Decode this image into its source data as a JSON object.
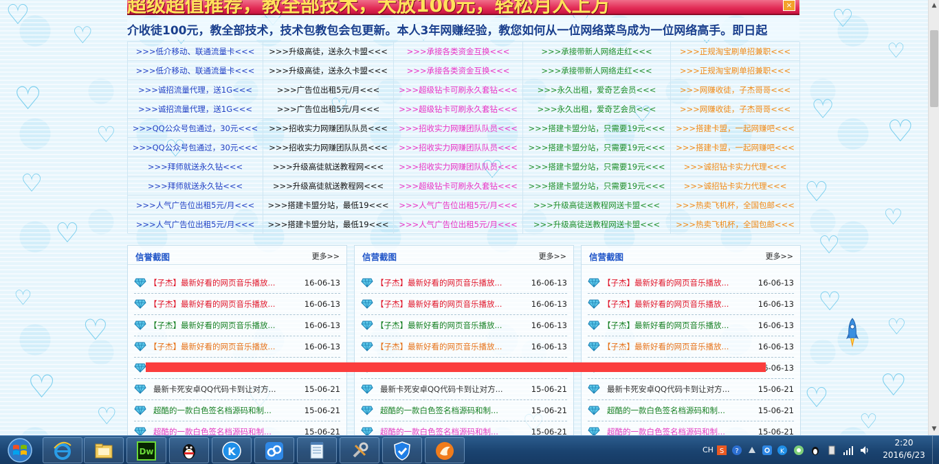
{
  "banner": {
    "text": "超级超值推荐，教全部技术，大放100元，轻松月入上万",
    "close_label": "×"
  },
  "marquee": {
    "text": "介收徒100元，教全部技术，技术包教包会包更新。本人3年网赚经验，教您如何从一位网络菜鸟成为一位网络高手。即日起"
  },
  "ad_grid": {
    "rows": [
      [
        ">>>低介移动、联通流量卡<<<",
        ">>>升级高徒，送永久卡盟<<<",
        ">>>承接各类资金互换<<<",
        ">>>承接带新人网络走红<<<",
        ">>>正规淘宝刷单招兼职<<<"
      ],
      [
        ">>>低介移动、联通流量卡<<<",
        ">>>升级高徒，送永久卡盟<<<",
        ">>>承接各类资金互换<<<",
        ">>>承接带新人网络走红<<<",
        ">>>正规淘宝刷单招兼职<<<"
      ],
      [
        ">>>诚招流量代理，送1G<<<",
        ">>>广告位出租5元/月<<<",
        ">>>超级钻卡可刷永久套钻<<<",
        ">>>永久出租，爱奇艺会员<<<",
        ">>>网赚收徒，子杰哥哥<<<"
      ],
      [
        ">>>诚招流量代理，送1G<<<",
        ">>>广告位出租5元/月<<<",
        ">>>超级钻卡可刷永久套钻<<<",
        ">>>永久出租，爱奇艺会员<<<",
        ">>>网赚收徒，子杰哥哥<<<"
      ],
      [
        ">>>QQ公众号包通过，30元<<<",
        ">>>招收实力网赚团队队员<<<",
        ">>>招收实力网赚团队队员<<<",
        ">>>搭建卡盟分站，只需要19元<<<",
        ">>>搭建卡盟，一起网赚吧<<<"
      ],
      [
        ">>>QQ公众号包通过，30元<<<",
        ">>>招收实力网赚团队队员<<<",
        ">>>招收实力网赚团队队员<<<",
        ">>>搭建卡盟分站，只需要19元<<<",
        ">>>搭建卡盟，一起网赚吧<<<"
      ],
      [
        ">>>拜师就送永久钻<<<",
        ">>>升级高徒就送教程网<<<",
        ">>>招收实力网赚团队队员<<<",
        ">>>搭建卡盟分站，只需要19元<<<",
        ">>>诚招钻卡实力代理<<<"
      ],
      [
        ">>>拜师就送永久钻<<<",
        ">>>升级高徒就送教程网<<<",
        ">>>超级钻卡可刷永久套钻<<<",
        ">>>搭建卡盟分站，只需要19元<<<",
        ">>>诚招钻卡实力代理<<<"
      ],
      [
        ">>>人气广告位出租5元/月<<<",
        ">>>搭建卡盟分站，最低19<<<",
        ">>>人气广告位出租5元/月<<<",
        ">>>升级高徒送教程网送卡盟<<<",
        ">>>热卖飞机杯，全国包邮<<<"
      ],
      [
        ">>>人气广告位出租5元/月<<<",
        ">>>搭建卡盟分站，最低19<<<",
        ">>>人气广告位出租5元/月<<<",
        ">>>升级高徒送教程网送卡盟<<<",
        ">>>热卖飞机杯，全国包邮<<<"
      ]
    ]
  },
  "panels": [
    {
      "title": "信誉截图",
      "more": "更多>>",
      "items": [
        {
          "title": "【子杰】最新好看的网页音乐播放...",
          "date": "16-06-13",
          "color": "t-red"
        },
        {
          "title": "【子杰】最新好看的网页音乐播放...",
          "date": "16-06-13",
          "color": "t-red"
        },
        {
          "title": "【子杰】最新好看的网页音乐播放...",
          "date": "16-06-13",
          "color": "t-green"
        },
        {
          "title": "【子杰】最新好看的网页音乐播放...",
          "date": "16-06-13",
          "color": "t-orange"
        },
        {
          "title": "",
          "date": "",
          "color": "t-dark"
        },
        {
          "title": "最新卡死安卓QQ代码卡到让对方...",
          "date": "15-06-21",
          "color": "t-dark",
          "indent": true
        },
        {
          "title": "超酷的一款白色签名档源码和制...",
          "date": "15-06-21",
          "color": "t-green",
          "indent": true
        },
        {
          "title": "超酷的一款白色签名档源码和制...",
          "date": "15-06-21",
          "color": "t-pink",
          "indent": true
        }
      ]
    },
    {
      "title": "信营截图",
      "more": "更多>>",
      "items": [
        {
          "title": "【子杰】最新好看的网页音乐播放...",
          "date": "16-06-13",
          "color": "t-red"
        },
        {
          "title": "【子杰】最新好看的网页音乐播放...",
          "date": "16-06-13",
          "color": "t-red"
        },
        {
          "title": "【子杰】最新好看的网页音乐播放...",
          "date": "16-06-13",
          "color": "t-green"
        },
        {
          "title": "【子杰】最新好看的网页音乐播放...",
          "date": "16-06-13",
          "color": "t-orange"
        },
        {
          "title": "",
          "date": "",
          "color": "t-dark"
        },
        {
          "title": "最新卡死安卓QQ代码卡到让对方...",
          "date": "15-06-21",
          "color": "t-dark",
          "indent": true
        },
        {
          "title": "超酷的一款白色签名档源码和制...",
          "date": "15-06-21",
          "color": "t-green",
          "indent": true
        },
        {
          "title": "超酷的一款白色签名档源码和制...",
          "date": "15-06-21",
          "color": "t-pink",
          "indent": true
        }
      ]
    },
    {
      "title": "信营截图",
      "more": "更多>>",
      "items": [
        {
          "title": "【子杰】最新好看的网页音乐播放...",
          "date": "16-06-13",
          "color": "t-red"
        },
        {
          "title": "【子杰】最新好看的网页音乐播放...",
          "date": "16-06-13",
          "color": "t-red"
        },
        {
          "title": "【子杰】最新好看的网页音乐播放...",
          "date": "16-06-13",
          "color": "t-green"
        },
        {
          "title": "【子杰】最新好看的网页音乐播放...",
          "date": "16-06-13",
          "color": "t-orange"
        },
        {
          "title": "",
          "date": "16-06-13",
          "color": "t-dark"
        },
        {
          "title": "最新卡死安卓QQ代码卡到让对方...",
          "date": "15-06-21",
          "color": "t-dark",
          "indent": true
        },
        {
          "title": "超酷的一款白色签名档源码和制...",
          "date": "15-06-21",
          "color": "t-green",
          "indent": true
        },
        {
          "title": "超酷的一款白色签名档源码和制...",
          "date": "15-06-21",
          "color": "t-pink",
          "indent": true
        }
      ]
    }
  ],
  "taskbar": {
    "start_icon": "windows-logo-icon",
    "apps": [
      {
        "name": "ie-icon"
      },
      {
        "name": "file-explorer-icon"
      },
      {
        "name": "dreamweaver-icon",
        "label": "Dw"
      },
      {
        "name": "qq-penguin-icon"
      },
      {
        "name": "kugou-music-icon",
        "label": "K"
      },
      {
        "name": "baidu-cloud-icon"
      },
      {
        "name": "notepad-icon"
      },
      {
        "name": "tools-icon"
      },
      {
        "name": "security-shield-icon"
      },
      {
        "name": "browser-fox-icon"
      }
    ],
    "language": "CH",
    "time": "2:20",
    "date": "2016/6/23"
  },
  "colors": {
    "accent": "#1f55c8",
    "banner_red": "#e22a55",
    "banner_text": "#ffe35b",
    "taskbar_blue": "#1a4370",
    "redbar": "#fb3d3d"
  }
}
